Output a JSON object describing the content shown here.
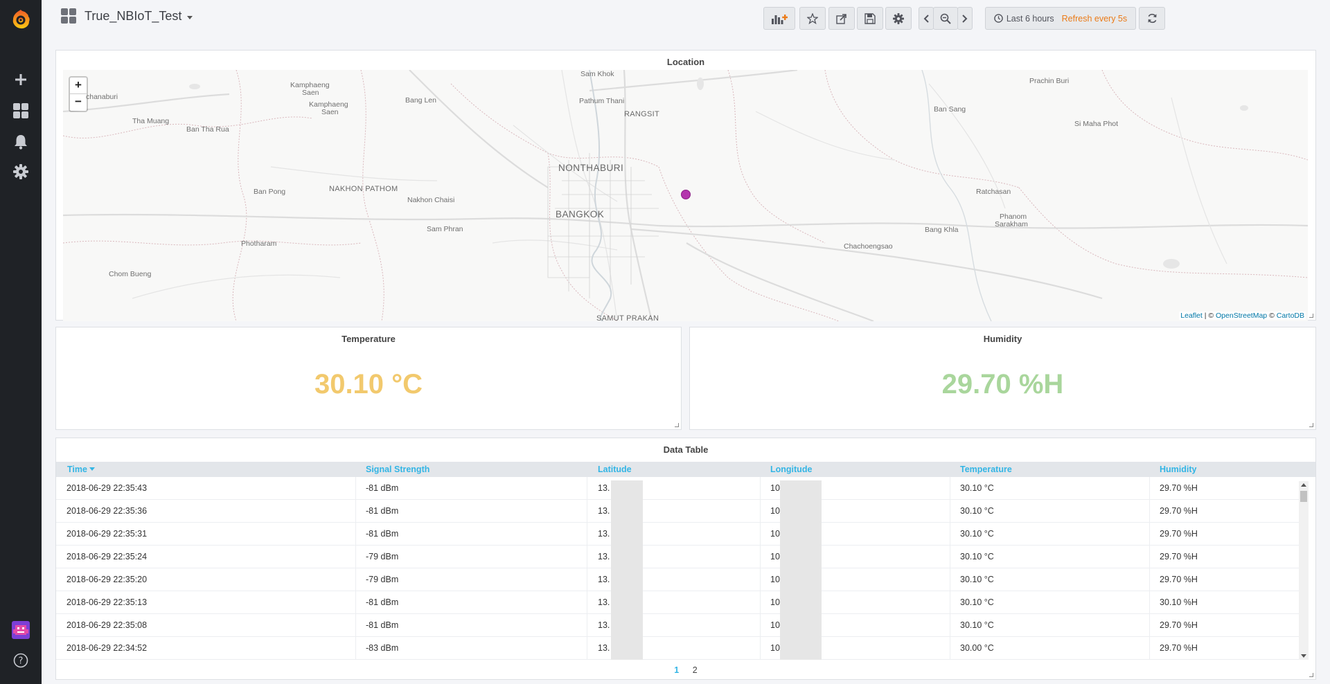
{
  "header": {
    "dashboard_title": "True_NBIoT_Test",
    "time_range": "Last 6 hours",
    "refresh": "Refresh every 5s"
  },
  "icons": {
    "logo": "grafana-logo-icon",
    "add": "plus-icon",
    "dashboards": "grid-icon",
    "alerts": "bell-icon",
    "config": "gear-icon",
    "profile": "avatar-icon",
    "help": "help-icon",
    "add_panel": "add-panel-icon",
    "star": "star-icon",
    "share": "share-icon",
    "save": "save-icon",
    "settings": "gear-icon",
    "prev": "chevron-left-icon",
    "zoom_out": "zoom-out-icon",
    "next": "chevron-right-icon",
    "clock": "clock-icon",
    "refresh": "refresh-icon"
  },
  "colors": {
    "sidebar_bg": "#1f2226",
    "accent": "#33b5e5",
    "refresh_text": "#eb7b18",
    "temperature_value": "#f2c96d",
    "humidity_value": "#a9d69c",
    "marker": "#b435ad"
  },
  "map_panel": {
    "title": "Location",
    "zoom_in": "+",
    "zoom_out": "−",
    "attribution": {
      "leaflet": "Leaflet",
      "sep1": " | © ",
      "osm": "OpenStreetMap",
      "sep2": " © ",
      "carto": "CartoDB"
    },
    "labels": {
      "sam_khok": "Sam Khok",
      "kamphaeng_saen_1a": "Kamphaeng",
      "kamphaeng_saen_1b": "Saen",
      "kamphaeng_saen_2a": "Kamphaeng",
      "kamphaeng_saen_2b": "Saen",
      "chanaburi": "chanaburi",
      "tha_muang": "Tha Muang",
      "ban_tha_rua": "Ban Tha Rua",
      "bang_len": "Bang Len",
      "pathum_thani": "Pathum Thani",
      "rangsit": "RANGSIT",
      "prachin_buri": "Prachin Buri",
      "ban_sang": "Ban Sang",
      "si_maha_phot": "Si Maha Phot",
      "nonthaburi": "NONTHABURI",
      "ban_pong": "Ban Pong",
      "nakhon_pathom": "NAKHON PATHOM",
      "nakhon_chaisi": "Nakhon Chaisi",
      "bangkok": "BANGKOK",
      "ratchasan": "Ratchasan",
      "phanom_sarakham_a": "Phanom",
      "phanom_sarakham_b": "Sarakham",
      "bang_khla": "Bang Khla",
      "sam_phran": "Sam Phran",
      "photharam": "Photharam",
      "chachoengsao": "Chachoengsao",
      "chom_bueng": "Chom Bueng",
      "samut_prakan": "SAMUT PRAKAN"
    }
  },
  "temperature_panel": {
    "title": "Temperature",
    "value": "30.10 °C"
  },
  "humidity_panel": {
    "title": "Humidity",
    "value": "29.70 %H"
  },
  "table_panel": {
    "title": "Data Table",
    "columns": [
      "Time",
      "Signal Strength",
      "Latitude",
      "Longitude",
      "Temperature",
      "Humidity"
    ],
    "rows": [
      [
        "2018-06-29 22:35:43",
        "-81 dBm",
        "13.",
        "10",
        "30.10 °C",
        "29.70 %H"
      ],
      [
        "2018-06-29 22:35:36",
        "-81 dBm",
        "13.",
        "10",
        "30.10 °C",
        "29.70 %H"
      ],
      [
        "2018-06-29 22:35:31",
        "-81 dBm",
        "13.",
        "10",
        "30.10 °C",
        "29.70 %H"
      ],
      [
        "2018-06-29 22:35:24",
        "-79 dBm",
        "13.",
        "10",
        "30.10 °C",
        "29.70 %H"
      ],
      [
        "2018-06-29 22:35:20",
        "-79 dBm",
        "13.",
        "10",
        "30.10 °C",
        "29.70 %H"
      ],
      [
        "2018-06-29 22:35:13",
        "-81 dBm",
        "13.",
        "10",
        "30.10 °C",
        "30.10 %H"
      ],
      [
        "2018-06-29 22:35:08",
        "-81 dBm",
        "13.",
        "10",
        "30.10 °C",
        "29.70 %H"
      ],
      [
        "2018-06-29 22:34:52",
        "-83 dBm",
        "13.",
        "10",
        "30.00 °C",
        "29.70 %H"
      ]
    ],
    "pages": [
      "1",
      "2"
    ],
    "active_page": "1"
  }
}
